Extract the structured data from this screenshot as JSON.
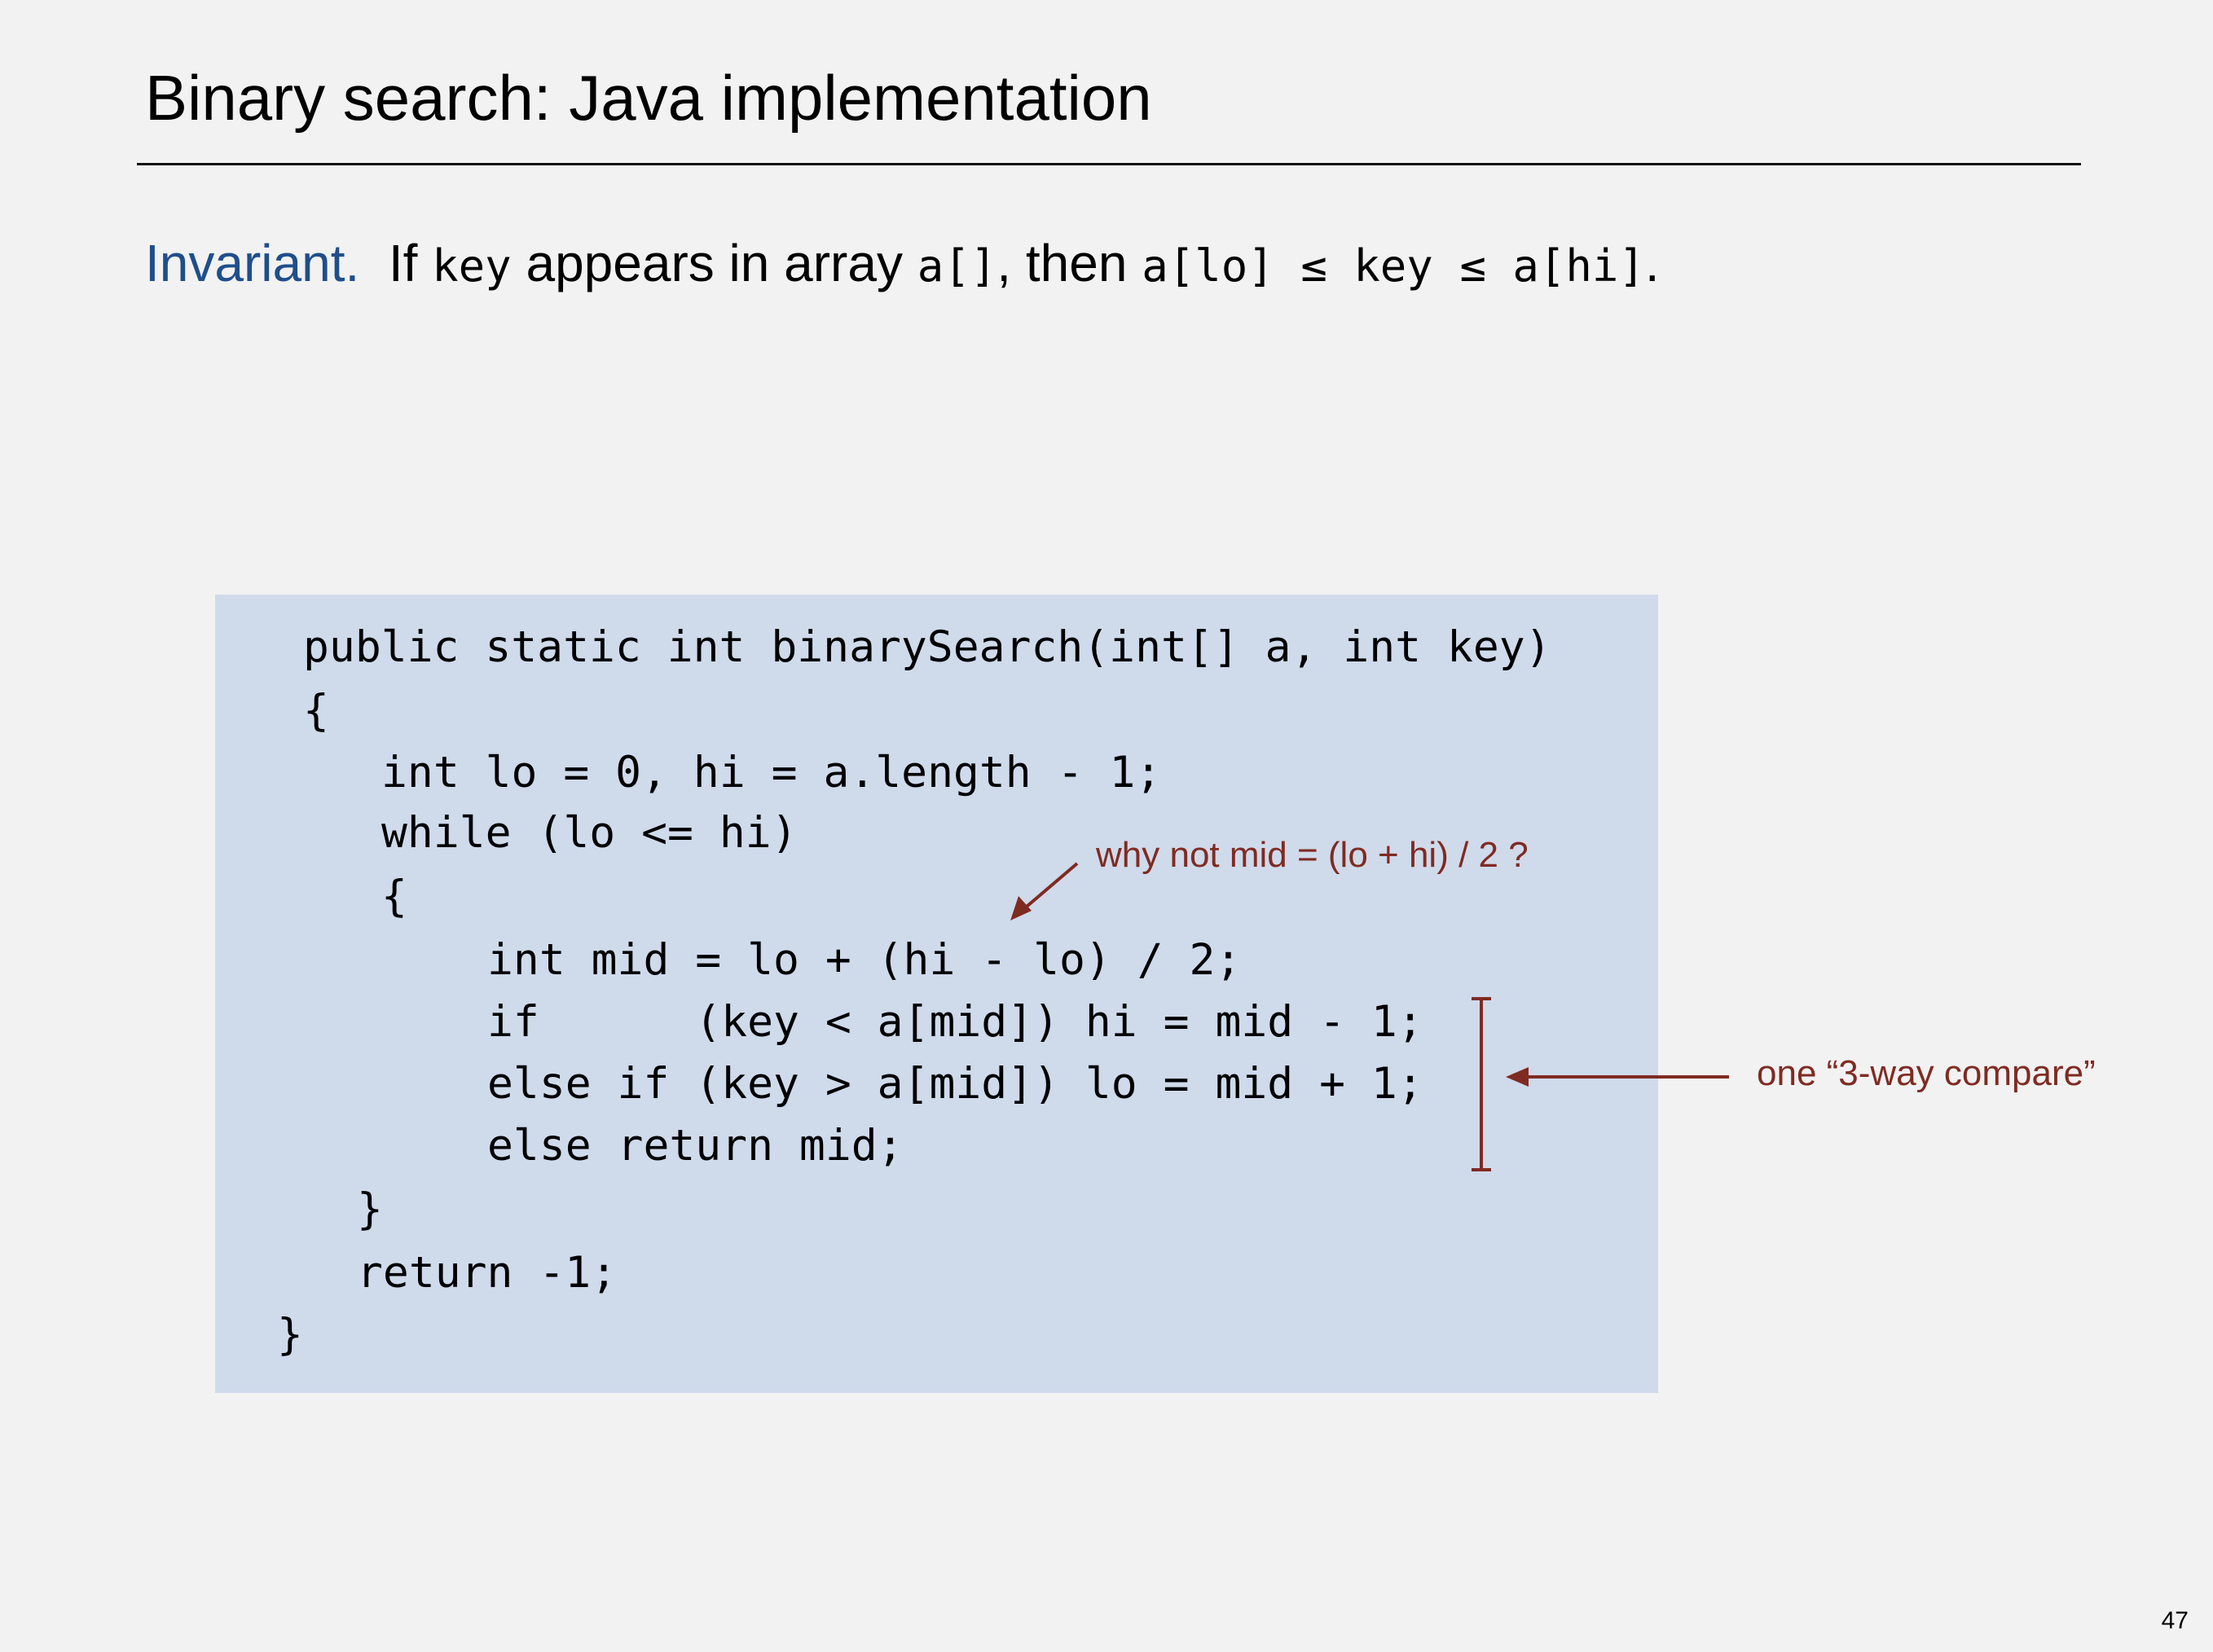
{
  "slide": {
    "title": "Binary search:  Java implementation",
    "page_number": "47"
  },
  "invariant": {
    "label": "Invariant.",
    "text_1": "If ",
    "code_1": "key",
    "text_2": " appears in array ",
    "code_2": "a[]",
    "text_3": ", then ",
    "code_3": "a[lo] ≤ key ≤ a[hi]",
    "text_4": "."
  },
  "code": {
    "lines": [
      "public static int binarySearch(int[] a, int key)",
      "{",
      "int lo = 0, hi = a.length - 1;",
      "while (lo <= hi)",
      "{",
      "int mid = lo + (hi - lo) / 2;",
      "if      (key < a[mid]) hi = mid - 1;",
      "else if (key > a[mid]) lo = mid + 1;",
      "else return mid;",
      "}",
      "return -1;",
      "}"
    ]
  },
  "annotations": {
    "mid_question": "why not mid = (lo + hi) / 2 ?",
    "compare_note": "one “3-way compare”",
    "color": "#7f2b22"
  },
  "colors": {
    "code_background": "#cfdaeb",
    "invariant_label": "#1f4e8c",
    "page_background": "#f2f2f2"
  }
}
